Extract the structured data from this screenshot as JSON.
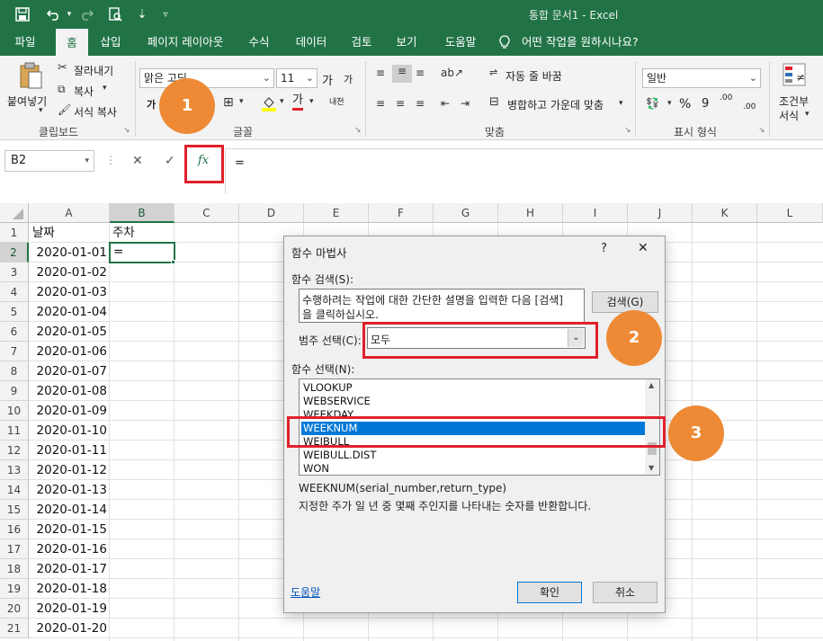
{
  "window": {
    "title": "통합 문서1  -  Excel",
    "quick_access": {
      "save_icon": "save-icon",
      "undo_icon": "undo-icon",
      "redo_icon": "redo-icon",
      "preview_icon": "print-preview-icon",
      "sort_icon": "sort-icon",
      "more_icon": "customize-icon"
    }
  },
  "tabs": [
    {
      "label": "파일"
    },
    {
      "label": "홈"
    },
    {
      "label": "삽입"
    },
    {
      "label": "페이지 레이아웃"
    },
    {
      "label": "수식"
    },
    {
      "label": "데이터"
    },
    {
      "label": "검토"
    },
    {
      "label": "보기"
    },
    {
      "label": "도움말"
    },
    {
      "label": "어떤 작업을 원하시나요?"
    }
  ],
  "ribbon": {
    "clipboard": {
      "paste": "붙여넣기",
      "cut": "잘라내기",
      "copy": "복사",
      "format_painter": "서식 복사",
      "group": "클립보드"
    },
    "font": {
      "font_name": "맑은 고딕",
      "font_size": "11",
      "group": "글꼴",
      "grow": "가",
      "shrink": "가",
      "bold": "가",
      "color_a": "가",
      "phonetic": "내천"
    },
    "alignment": {
      "wrap": "자동 줄 바꿈",
      "merge": "병합하고 가운데 맞춤",
      "group": "맞춤"
    },
    "number": {
      "format": "일반",
      "percent": "%",
      "comma": "9",
      "group": "표시 형식",
      "inc": ".00",
      "dec": ".00"
    },
    "styles": {
      "conditional_l1": "조건부",
      "conditional_l2": "서식"
    }
  },
  "formula_bar": {
    "name_box": "B2",
    "cancel": "✕",
    "enter": "✓",
    "fx": "fx",
    "content": "="
  },
  "sheet": {
    "columns": [
      "A",
      "B",
      "C",
      "D",
      "E",
      "F",
      "G",
      "H",
      "I",
      "J",
      "K",
      "L"
    ],
    "rows": [
      "1",
      "2",
      "3",
      "4",
      "5",
      "6",
      "7",
      "8",
      "9",
      "10",
      "11",
      "12",
      "13",
      "14",
      "15",
      "16",
      "17",
      "18",
      "19",
      "20",
      "21"
    ],
    "headers": {
      "a1": "날짜",
      "b1": "주차"
    },
    "b2_value": "=",
    "dates": [
      "2020-01-01",
      "2020-01-02",
      "2020-01-03",
      "2020-01-04",
      "2020-01-05",
      "2020-01-06",
      "2020-01-07",
      "2020-01-08",
      "2020-01-09",
      "2020-01-10",
      "2020-01-11",
      "2020-01-12",
      "2020-01-13",
      "2020-01-14",
      "2020-01-15",
      "2020-01-16",
      "2020-01-17",
      "2020-01-18",
      "2020-01-19",
      "2020-01-20"
    ]
  },
  "dialog": {
    "title": "함수 마법사",
    "help_q": "?",
    "close": "✕",
    "search_label": "함수 검색(S):",
    "search_text_1": "수행하려는 작업에 대한 간단한 설명을 입력한 다음 [검색]",
    "search_text_2": "을 클릭하십시오.",
    "search_button": "검색(G)",
    "category_label": "범주 선택(C):",
    "category_value": "모두",
    "function_label": "함수 선택(N):",
    "functions": [
      "VLOOKUP",
      "WEBSERVICE",
      "WEEKDAY",
      "WEEKNUM",
      "WEIBULL",
      "WEIBULL.DIST",
      "WON"
    ],
    "selected_function": "WEEKNUM",
    "signature": "WEEKNUM(serial_number,return_type)",
    "description": "지정한 주가 일 년 중 몇째 주인지를 나타내는 숫자를 반환합니다.",
    "help_link": "도움말",
    "ok": "확인",
    "cancel": "취소"
  },
  "annotations": {
    "badge1": "1",
    "badge2": "2",
    "badge3": "3"
  },
  "colors": {
    "excel_green": "#217346",
    "annotation_red": "#e0212b",
    "badge_orange": "#ee8a35",
    "selection_blue": "#0078d7"
  }
}
